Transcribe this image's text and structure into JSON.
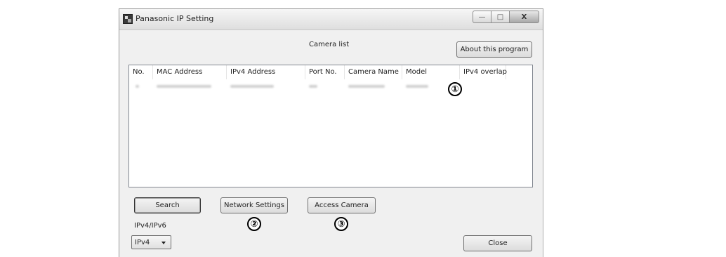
{
  "window": {
    "title": "Panasonic IP Setting",
    "controls": {
      "minimize": "—",
      "maximize": "□",
      "close": "X"
    }
  },
  "camera_list_label": "Camera list",
  "about_button": "About this program",
  "table": {
    "columns": [
      "No.",
      "MAC Address",
      "IPv4 Address",
      "Port No.",
      "Camera Name",
      "Model",
      "IPv4 overlap"
    ],
    "rows_blurred": true
  },
  "buttons": {
    "search": "Search",
    "network_settings": "Network Settings",
    "access_camera": "Access Camera",
    "close": "Close"
  },
  "ip_version": {
    "label": "IPv4/IPv6",
    "selected": "IPv4"
  },
  "callouts": [
    "①",
    "②",
    "③"
  ]
}
